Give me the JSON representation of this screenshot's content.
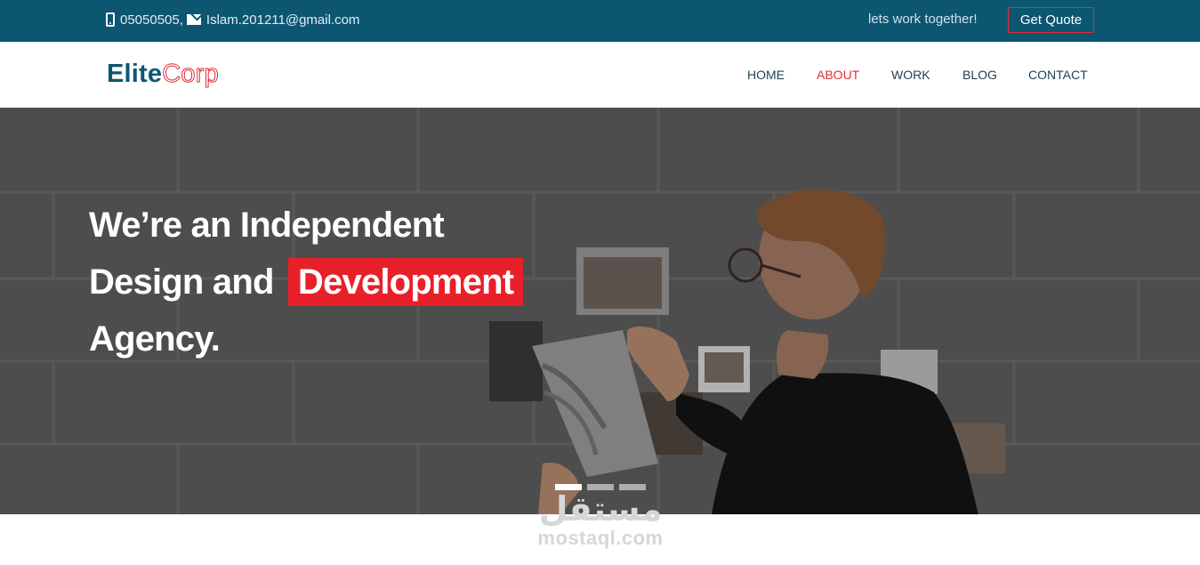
{
  "topbar": {
    "phone": "05050505,",
    "email": "Islam.201211@gmail.com",
    "tagline": "lets work together!",
    "quote_button": "Get Quote",
    "phone_icon": "mobile-phone-icon",
    "email_icon": "envelope-icon"
  },
  "brand": {
    "part1": "Elite",
    "part2": "Corp"
  },
  "nav": {
    "items": [
      {
        "label": "HOME",
        "active": false
      },
      {
        "label": "ABOUT",
        "active": true
      },
      {
        "label": "WORK",
        "active": false
      },
      {
        "label": "BLOG",
        "active": false
      },
      {
        "label": "CONTACT",
        "active": false
      }
    ]
  },
  "hero": {
    "line1": "We’re an Independent",
    "line2_prefix": "Design and",
    "line2_highlight": "Development",
    "line3": "Agency.",
    "slides": {
      "count": 3,
      "active": 1
    }
  },
  "watermark": {
    "arabic": "مستقل",
    "latin": "mostaql.com"
  },
  "colors": {
    "topbar": "#0d5672",
    "accent": "#e52a35",
    "highlight": "#e8202a",
    "nav_text": "#1d3e52"
  }
}
